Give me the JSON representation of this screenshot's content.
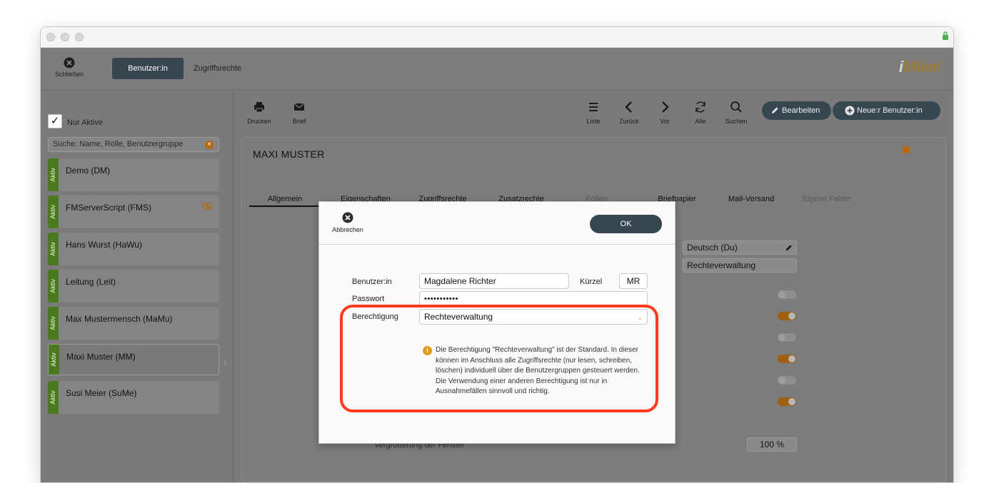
{
  "window": {
    "lock_icon": "lock-icon"
  },
  "topbar": {
    "close_label": "Schließen",
    "tab_active": "Benutzer:in",
    "tab_other": "Zugriffsrechte",
    "logo_prefix": "i",
    "logo_text": "Mikel"
  },
  "sidebar": {
    "filter_label": "Nur Aktive",
    "filter_check": "✓",
    "search_placeholder": "Suche: Name, Rolle, Benutzergruppe",
    "status_badge": "Aktiv",
    "users": [
      {
        "name": "Demo (DM)"
      },
      {
        "name": "FMServerScript (FMS)"
      },
      {
        "name": "Hans Wurst (HaWu)"
      },
      {
        "name": "Leitung (Leit)"
      },
      {
        "name": "Max Mustermensch (MaMu)"
      },
      {
        "name": "Maxi Muster (MM)"
      },
      {
        "name": "Susi Meier (SuMe)"
      }
    ]
  },
  "toolbar": {
    "print": "Drucken",
    "letter": "Brief",
    "list": "Liste",
    "back": "Zurück",
    "forward": "Vor",
    "all": "Alle",
    "search": "Suchen",
    "edit": "Bearbeiten",
    "new_user": "Neue:r Benutzer:in"
  },
  "record": {
    "title": "MAXI MUSTER",
    "tabs": [
      "Allgemein",
      "Eigenschaften",
      "Zugriffsrechte",
      "Zusatzrechte",
      "Rollen",
      "Briefpapier",
      "Mail-Versand",
      "Eigene Felder"
    ],
    "language": "Deutsch (Du)",
    "permission": "Rechteverwaltung",
    "window_zoom_label": "Vergrößerung der Fenster",
    "window_zoom_value": "100 %"
  },
  "dialog": {
    "cancel": "Abbrechen",
    "ok": "OK",
    "user_label": "Benutzer:in",
    "user_value": "Magdalene Richter",
    "short_label": "Kürzel",
    "short_value": "MR",
    "password_label": "Passwort",
    "password_value": "•••••••••••",
    "permission_label": "Berechtigung",
    "permission_value": "Rechteverwaltung",
    "info_glyph": "i",
    "info_text": "Die Berechtigung \"Rechteverwaltung\" ist der Standard. In dieser können im Anschluss alle Zugriffsrechte (nur lesen, schreiben, löschen) individuell über die Benutzergruppen gesteuert werden. Die Verwendung einer anderen Berechtigung ist nur in Ausnahmefällen sinnvoll und richtig."
  },
  "colors": {
    "accent_dark": "#37474f",
    "active_green": "#4b7a1e",
    "toggle_orange": "#a15f10",
    "highlight_red": "#ff3b1f"
  }
}
